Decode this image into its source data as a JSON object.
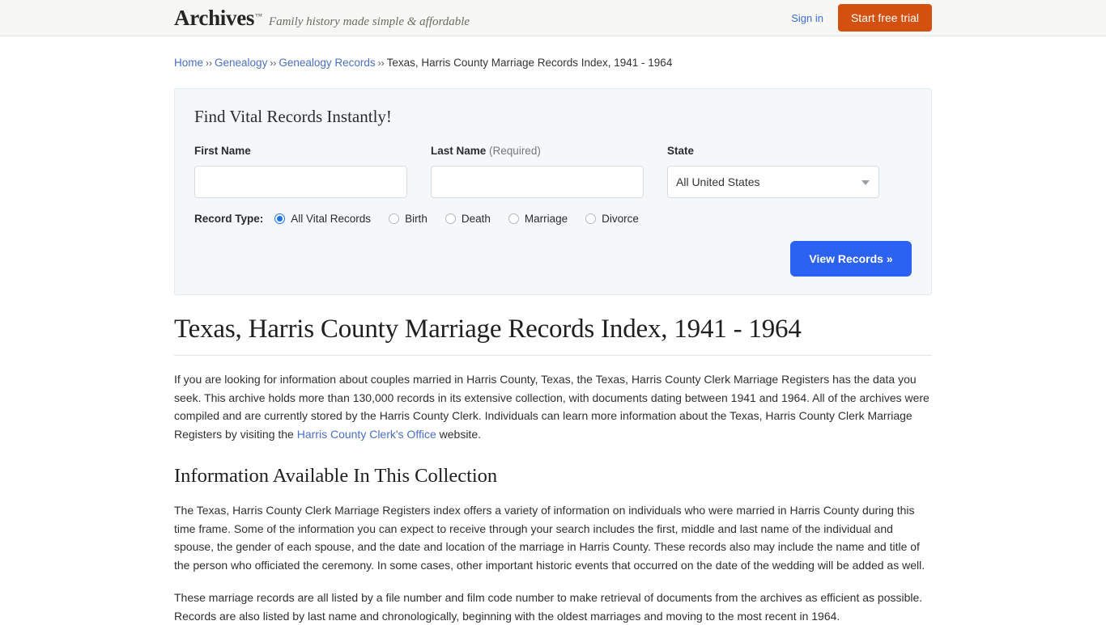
{
  "header": {
    "brand_name": "Archives",
    "brand_tm": "™",
    "tagline": "Family history made simple & affordable",
    "signin_label": "Sign in",
    "trial_label": "Start free trial",
    "trial_color": "#d4500f",
    "link_color": "#3b6fd4"
  },
  "breadcrumb": {
    "items": [
      {
        "label": "Home",
        "link": true
      },
      {
        "label": "Genealogy",
        "link": true
      },
      {
        "label": "Genealogy Records",
        "link": true
      },
      {
        "label": "Texas, Harris County Marriage Records Index, 1941 - 1964",
        "link": false
      }
    ],
    "separator": "››"
  },
  "search_panel": {
    "title": "Find Vital Records Instantly!",
    "first_name": {
      "label": "First Name",
      "value": "",
      "placeholder": ""
    },
    "last_name": {
      "label": "Last Name",
      "required_note": "(Required)",
      "value": "",
      "placeholder": ""
    },
    "state": {
      "label": "State",
      "selected": "All United States"
    },
    "record_type": {
      "label": "Record Type:",
      "options": [
        {
          "label": "All Vital Records",
          "checked": true
        },
        {
          "label": "Birth",
          "checked": false
        },
        {
          "label": "Death",
          "checked": false
        },
        {
          "label": "Marriage",
          "checked": false
        },
        {
          "label": "Divorce",
          "checked": false
        }
      ],
      "accent_color": "#1a73e8"
    },
    "submit_label": "View Records »",
    "submit_color": "#2b62f2"
  },
  "article": {
    "title": "Texas, Harris County Marriage Records Index, 1941 - 1964",
    "intro_part1": "If you are looking for information about couples married in Harris County, Texas, the Texas, Harris County Clerk Marriage Registers has the data you seek. This archive holds more than 130,000 records in its extensive collection, with documents dating between 1941 and 1964. All of the archives were compiled and are currently stored by the Harris County Clerk. Individuals can learn more information about the Texas, Harris County Clerk Marriage Registers by visiting the ",
    "intro_link": "Harris County Clerk's Office",
    "intro_part2": " website.",
    "section_title": "Information Available In This Collection",
    "paragraph_2": "The Texas, Harris County Clerk Marriage Registers index offers a variety of information on individuals who were married in Harris County during this time frame. Some of the information you can expect to receive through your search includes the first, middle and last name of the individual and spouse, the gender of each spouse, and the date and location of the marriage in Harris County. These records also may include the name and title of the person who officiated the ceremony. In some cases, other important historic events that occurred on the date of the wedding will be added as well.",
    "paragraph_3": "These marriage records are all listed by a file number and film code number to make retrieval of documents from the archives as efficient as possible. Records are also listed by last name and chronologically, beginning with the oldest marriages and moving to the most recent in 1964."
  }
}
